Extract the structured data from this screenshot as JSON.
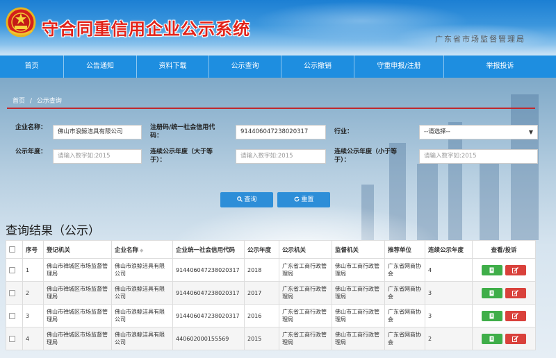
{
  "header": {
    "site_title": "守合同重信用企业公示系统",
    "subtitle": "广东省市场监督管理局"
  },
  "nav": [
    "首页",
    "公告通知",
    "资料下载",
    "公示查询",
    "公示撤销",
    "守重申报/注册",
    "举报投诉"
  ],
  "breadcrumb": {
    "home": "首页",
    "sep": "/",
    "current": "公示查询"
  },
  "form": {
    "company_label": "企业名称：",
    "company_value": "佛山市浪鲸洁具有限公司",
    "regno_label": "注册码/统一社会信用代码：",
    "regno_value": "91440604723802031​7",
    "industry_label": "行业：",
    "industry_value": "--请选择--",
    "year_label": "公示年度：",
    "year_placeholder": "请输入数字如:2015",
    "cont_ge_label": "连续公示年度（大于等于）：",
    "cont_ge_placeholder": "请输入数字如:2015",
    "cont_le_label": "连续公示年度（小于等于）：",
    "cont_le_placeholder": "请输入数字如:2015"
  },
  "buttons": {
    "search": "查询",
    "reset": "重置"
  },
  "results_title": "查询结果（公示）",
  "table": {
    "headers": [
      "序号",
      "登记机关",
      "企业名称",
      "企业统一社会信用代码",
      "公示年度",
      "公示机关",
      "监督机关",
      "推荐单位",
      "连续公示年度",
      "查看/投诉"
    ],
    "rows": [
      [
        "1",
        "佛山市禅城区市场监督管理局",
        "佛山市浪鲸洁具有限公司",
        "914406047238020317",
        "2018",
        "广东省工商行政管理局",
        "佛山市工商行政管理局",
        "广东省网商协会",
        "4"
      ],
      [
        "2",
        "佛山市禅城区市场监督管理局",
        "佛山市浪鲸洁具有限公司",
        "914406047238020317",
        "2017",
        "广东省工商行政管理局",
        "佛山市工商行政管理局",
        "广东省网商协会",
        "3"
      ],
      [
        "3",
        "佛山市禅城区市场监督管理局",
        "佛山市浪鲸洁具有限公司",
        "914406047238020317",
        "2016",
        "广东省工商行政管理局",
        "佛山市工商行政管理局",
        "广东省网商协会",
        "3"
      ],
      [
        "4",
        "佛山市禅城区市场监督管理局",
        "佛山市浪鲸洁具有限公司",
        "440602000155569",
        "2015",
        "广东省工商行政管理局",
        "佛山市工商行政管理局",
        "广东省网商协会",
        "2"
      ]
    ]
  },
  "icons": {
    "emblem": "national-emblem-icon",
    "search": "search-icon",
    "reset": "refresh-icon",
    "view": "document-icon",
    "complain": "edit-icon"
  },
  "colors": {
    "nav_bg": "#1e8ee0",
    "title_red": "#e2231a",
    "button_blue": "#2d8ed8",
    "view_green": "#3fae49",
    "complain_red": "#d9413b",
    "rule_red": "#c0282d"
  }
}
